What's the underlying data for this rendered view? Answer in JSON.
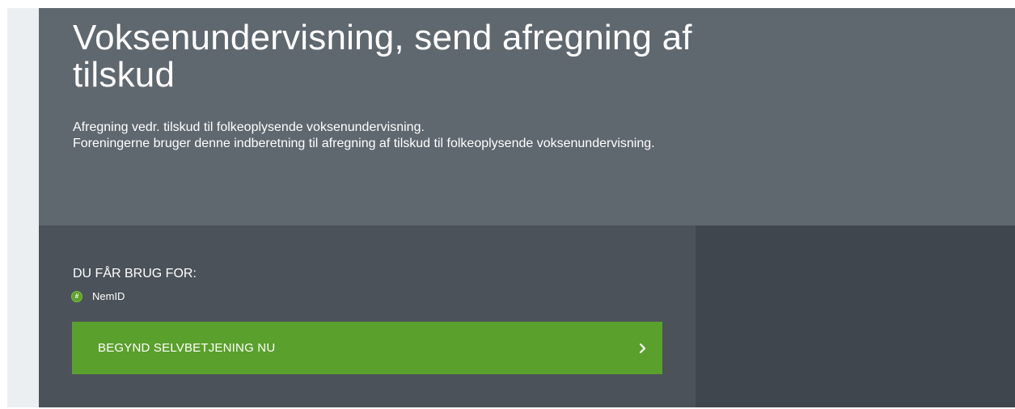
{
  "hero": {
    "title": "Voksenundervisning, send afregning af tilskud",
    "description_lines": [
      "Afregning vedr. tilskud til folkeoplysende voksenundervisning.",
      "Foreningerne bruger denne indberetning til afregning af tilskud til folkeoplysende voksenundervisning."
    ]
  },
  "requirements": {
    "heading": "DU FÅR BRUG FOR:",
    "items": [
      {
        "label": "NemID",
        "icon": "nemid-icon",
        "icon_glyph": "#"
      }
    ]
  },
  "start_button": {
    "label": "BEGYND SELVBETJENING NU",
    "icon": "chevron-right-icon"
  },
  "colors": {
    "hero_background": "#5f676f",
    "panel_left": "#4b5259",
    "panel_right": "#40464d",
    "accent_green": "#5aa02c",
    "side_strip": "#eceff1"
  }
}
